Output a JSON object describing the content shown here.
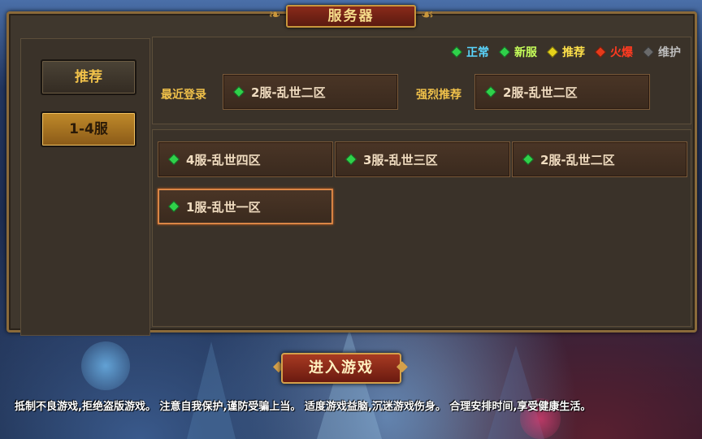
{
  "window": {
    "title": "服务器"
  },
  "sidebar": {
    "items": [
      {
        "label": "推荐"
      },
      {
        "label": "1-4服"
      }
    ]
  },
  "legend": [
    {
      "label": "正常",
      "color": "#2fd14a",
      "text_color": "#5ad6ff"
    },
    {
      "label": "新服",
      "color": "#2fd14a",
      "text_color": "#c6ff5a"
    },
    {
      "label": "推荐",
      "color": "#e6d21a",
      "text_color": "#ffe14a"
    },
    {
      "label": "火爆",
      "color": "#e63a1a",
      "text_color": "#ff3a20"
    },
    {
      "label": "维护",
      "color": "#6a6a6a",
      "text_color": "#bdbdbd"
    }
  ],
  "recent": {
    "label": "最近登录",
    "server": "2服-乱世二区"
  },
  "recommend": {
    "label": "强烈推荐",
    "server": "2服-乱世二区"
  },
  "servers": [
    {
      "name": "4服-乱世四区",
      "status_color": "#2fd14a"
    },
    {
      "name": "3服-乱世三区",
      "status_color": "#2fd14a"
    },
    {
      "name": "2服-乱世二区",
      "status_color": "#2fd14a"
    },
    {
      "name": "1服-乱世一区",
      "status_color": "#2fd14a"
    }
  ],
  "enter_button": "进入游戏",
  "notice": "抵制不良游戏,拒绝盗版游戏。 注意自我保护,谨防受骗上当。 适度游戏益脑,沉迷游戏伤身。 合理安排时间,享受健康生活。"
}
